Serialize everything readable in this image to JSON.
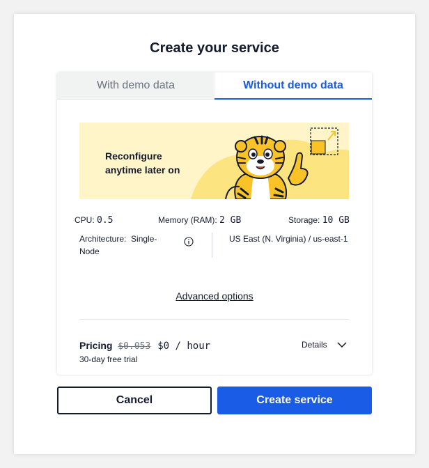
{
  "dialog": {
    "title": "Create your service"
  },
  "tabs": [
    {
      "label": "With demo data",
      "active": false
    },
    {
      "label": "Without demo data",
      "active": true
    }
  ],
  "banner": {
    "line1": "Reconfigure",
    "line2": "anytime later on",
    "illustration": "tiger-mascot-icon"
  },
  "specs": {
    "cpu_label": "CPU:",
    "cpu_value": "0.5",
    "memory_label": "Memory (RAM):",
    "memory_value": "2 GB",
    "storage_label": "Storage:",
    "storage_value": "10 GB",
    "architecture_label": "Architecture:",
    "architecture_value": "Single-Node",
    "region": "US East (N. Virginia) / us-east-1"
  },
  "advanced_options": "Advanced options",
  "pricing": {
    "label": "Pricing",
    "old_price": "$0.053",
    "new_price": "$0 / hour",
    "trial": "30-day free trial",
    "details_label": "Details"
  },
  "buttons": {
    "cancel": "Cancel",
    "create": "Create service"
  },
  "colors": {
    "accent": "#1a5ce5",
    "banner_bg": "#fff5c9",
    "text": "#141b2d"
  }
}
